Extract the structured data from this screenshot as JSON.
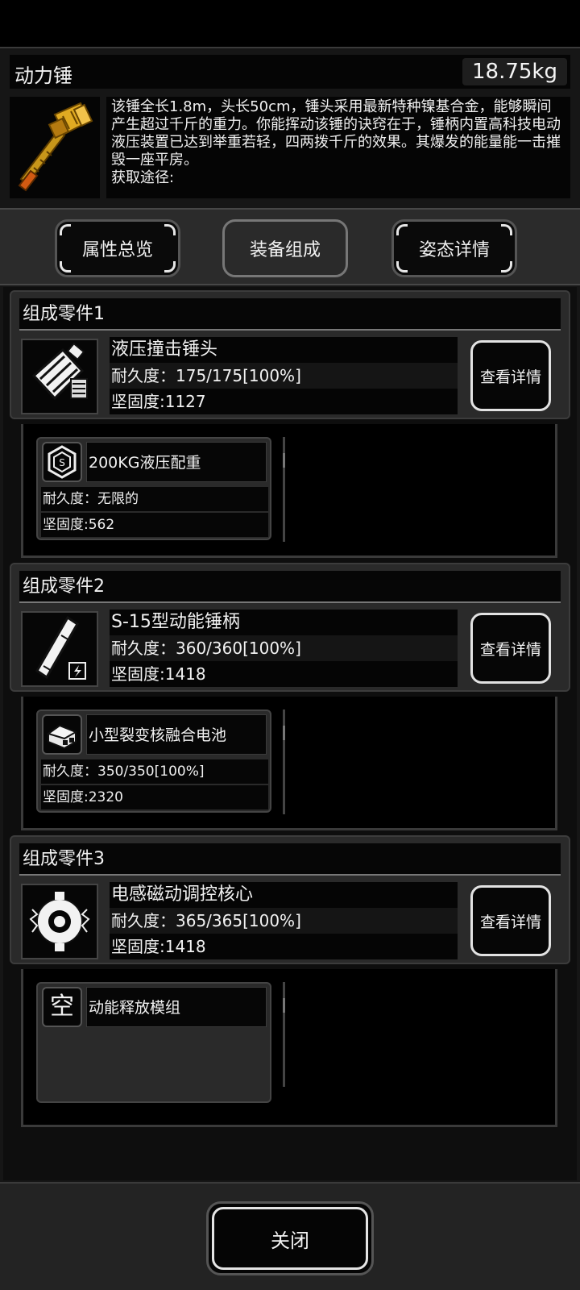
{
  "header": {
    "title": "动力锤",
    "weight": "18.75kg",
    "description": "该锤全长1.8m，头长50cm，锤头采用最新特种镍基合金，能够瞬间产生超过千斤的重力。你能挥动该锤的诀窍在于，锤柄内置高科技电动液压装置已达到举重若轻，四两拨千斤的效果。其爆发的能量能一击摧毁一座平房。",
    "source": "获取途径:"
  },
  "tabs": [
    {
      "label": "属性总览",
      "active": false
    },
    {
      "label": "装备组成",
      "active": true
    },
    {
      "label": "姿态详情",
      "active": false
    }
  ],
  "parts": [
    {
      "header": "组成零件1",
      "name": "液压撞击锤头",
      "durability": "耐久度：175/175[100%]",
      "hardness": "坚固度:1127",
      "detail_label": "查看详情",
      "icon": "hammer-head-icon",
      "sub": {
        "name": "200KG液压配重",
        "durability": "耐久度：无限的",
        "hardness": "坚固度:562",
        "icon": "hex-weight-icon"
      }
    },
    {
      "header": "组成零件2",
      "name": "S-15型动能锤柄",
      "durability": "耐久度：360/360[100%]",
      "hardness": "坚固度:1418",
      "detail_label": "查看详情",
      "icon": "handle-icon",
      "sub": {
        "name": "小型裂变核融合电池",
        "durability": "耐久度：350/350[100%]",
        "hardness": "坚固度:2320",
        "icon": "battery-icon"
      }
    },
    {
      "header": "组成零件3",
      "name": "电感磁动调控核心",
      "durability": "耐久度：365/365[100%]",
      "hardness": "坚固度:1418",
      "detail_label": "查看详情",
      "icon": "core-icon",
      "sub": {
        "name": "动能释放模组",
        "empty_label": "空",
        "icon": "empty-slot-icon"
      }
    }
  ],
  "footer": {
    "close_label": "关闭"
  },
  "colors": {
    "background": "#161616",
    "panel": "#2a2a2a",
    "accent_gold": "#d9a21a"
  }
}
